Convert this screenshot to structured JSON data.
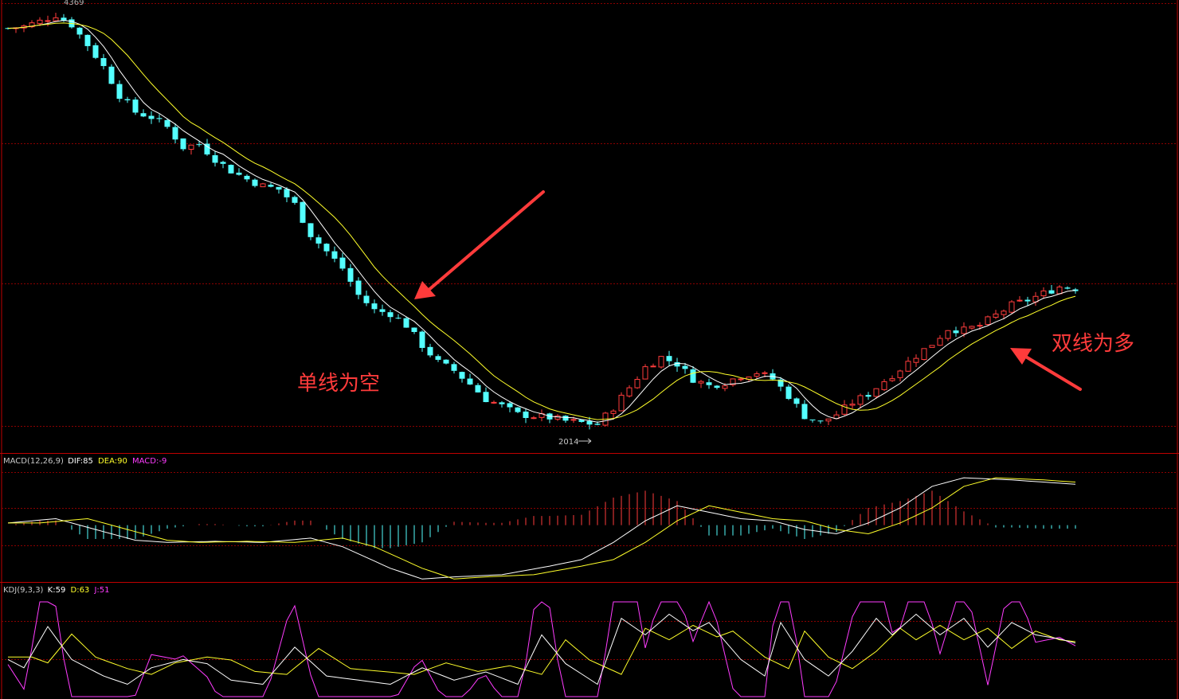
{
  "top_marker": "4369",
  "year_marker": "2014",
  "annotations": {
    "single_line": "单线为空",
    "double_line": "双线为多"
  },
  "macd_panel": {
    "name": "MACD(12,26,9)",
    "dif": "DIF:85",
    "dea": "DEA:90",
    "macd": "MACD:-9"
  },
  "kdj_panel": {
    "name": "KDJ(9,3,3)",
    "k": "K:59",
    "d": "D:63",
    "j": "J:51"
  },
  "colors": {
    "background": "#000000",
    "up": "#ff3c3c",
    "down": "#54ffff",
    "ma_fast": "#ffffff",
    "ma_slow": "#ffff2a",
    "grid": "#8b0000",
    "panel_border": "#c00000",
    "dif": "#ffffff",
    "dea": "#ffff2a",
    "k": "#ffffff",
    "d": "#ffff2a",
    "j": "#ff3cff",
    "annotation": "#ff3b3b",
    "arrow": "#ff3b3b"
  },
  "chart_data": [
    {
      "type": "candlestick",
      "title": "",
      "anchors": [
        [
          0,
          4290
        ],
        [
          2,
          4300
        ],
        [
          4,
          4330
        ],
        [
          6,
          4369
        ],
        [
          8,
          4310
        ],
        [
          10,
          4190
        ],
        [
          12,
          4060
        ],
        [
          14,
          3890
        ],
        [
          16,
          3790
        ],
        [
          18,
          3760
        ],
        [
          20,
          3700
        ],
        [
          22,
          3580
        ],
        [
          24,
          3600
        ],
        [
          26,
          3510
        ],
        [
          28,
          3440
        ],
        [
          30,
          3390
        ],
        [
          32,
          3350
        ],
        [
          34,
          3330
        ],
        [
          36,
          3240
        ],
        [
          38,
          3060
        ],
        [
          40,
          2960
        ],
        [
          42,
          2860
        ],
        [
          44,
          2700
        ],
        [
          46,
          2610
        ],
        [
          48,
          2590
        ],
        [
          50,
          2520
        ],
        [
          52,
          2400
        ],
        [
          54,
          2300
        ],
        [
          56,
          2250
        ],
        [
          58,
          2170
        ],
        [
          60,
          2080
        ],
        [
          62,
          2040
        ],
        [
          64,
          1990
        ],
        [
          66,
          1980
        ],
        [
          68,
          1970
        ],
        [
          70,
          1950
        ],
        [
          72,
          1940
        ],
        [
          74,
          1930
        ],
        [
          76,
          2030
        ],
        [
          78,
          2150
        ],
        [
          80,
          2270
        ],
        [
          82,
          2330
        ],
        [
          84,
          2290
        ],
        [
          86,
          2200
        ],
        [
          88,
          2160
        ],
        [
          90,
          2180
        ],
        [
          92,
          2220
        ],
        [
          94,
          2240
        ],
        [
          96,
          2200
        ],
        [
          98,
          2100
        ],
        [
          100,
          1980
        ],
        [
          102,
          1940
        ],
        [
          104,
          1990
        ],
        [
          106,
          2060
        ],
        [
          108,
          2110
        ],
        [
          110,
          2190
        ],
        [
          112,
          2260
        ],
        [
          114,
          2340
        ],
        [
          116,
          2410
        ],
        [
          118,
          2500
        ],
        [
          120,
          2490
        ],
        [
          122,
          2520
        ],
        [
          124,
          2580
        ],
        [
          126,
          2640
        ],
        [
          128,
          2670
        ],
        [
          130,
          2710
        ],
        [
          132,
          2750
        ],
        [
          134,
          2740
        ]
      ],
      "candle_count": 135,
      "noise_amplitude": 45,
      "ylim": [
        1850,
        4420
      ],
      "moving_averages": [
        {
          "period": 5,
          "color_key": "ma_fast"
        },
        {
          "period": 10,
          "color_key": "ma_slow"
        }
      ]
    },
    {
      "type": "macd",
      "dif_curve": [
        [
          0,
          10
        ],
        [
          6,
          30
        ],
        [
          10,
          -10
        ],
        [
          16,
          -70
        ],
        [
          20,
          -80
        ],
        [
          26,
          -75
        ],
        [
          32,
          -80
        ],
        [
          38,
          -60
        ],
        [
          42,
          -100
        ],
        [
          48,
          -200
        ],
        [
          52,
          -250
        ],
        [
          56,
          -240
        ],
        [
          62,
          -230
        ],
        [
          68,
          -190
        ],
        [
          72,
          -160
        ],
        [
          76,
          -80
        ],
        [
          80,
          20
        ],
        [
          84,
          90
        ],
        [
          88,
          60
        ],
        [
          92,
          30
        ],
        [
          96,
          20
        ],
        [
          100,
          -20
        ],
        [
          104,
          -40
        ],
        [
          108,
          10
        ],
        [
          112,
          80
        ],
        [
          116,
          180
        ],
        [
          120,
          220
        ],
        [
          126,
          210
        ],
        [
          130,
          200
        ],
        [
          134,
          190
        ]
      ],
      "dea_lag": 4,
      "ylim": [
        -260,
        250
      ],
      "last_values": {
        "dif": 85,
        "dea": 90,
        "macd": -9
      }
    },
    {
      "type": "kdj",
      "k_curve": [
        [
          0,
          40
        ],
        [
          2,
          30
        ],
        [
          5,
          80
        ],
        [
          8,
          40
        ],
        [
          12,
          20
        ],
        [
          15,
          10
        ],
        [
          18,
          30
        ],
        [
          22,
          40
        ],
        [
          25,
          35
        ],
        [
          28,
          15
        ],
        [
          32,
          10
        ],
        [
          36,
          55
        ],
        [
          40,
          20
        ],
        [
          44,
          15
        ],
        [
          48,
          10
        ],
        [
          52,
          30
        ],
        [
          56,
          15
        ],
        [
          60,
          25
        ],
        [
          64,
          10
        ],
        [
          67,
          70
        ],
        [
          70,
          35
        ],
        [
          74,
          10
        ],
        [
          77,
          90
        ],
        [
          80,
          70
        ],
        [
          83,
          95
        ],
        [
          86,
          75
        ],
        [
          88,
          85
        ],
        [
          92,
          40
        ],
        [
          95,
          20
        ],
        [
          97,
          85
        ],
        [
          100,
          40
        ],
        [
          103,
          20
        ],
        [
          106,
          50
        ],
        [
          109,
          90
        ],
        [
          111,
          70
        ],
        [
          114,
          95
        ],
        [
          117,
          70
        ],
        [
          120,
          90
        ],
        [
          123,
          55
        ],
        [
          126,
          85
        ],
        [
          129,
          70
        ],
        [
          132,
          65
        ],
        [
          134,
          60
        ]
      ],
      "d_lag": 3,
      "ylim": [
        -5,
        110
      ],
      "last_values": {
        "k": 59,
        "d": 63,
        "j": 51
      }
    }
  ]
}
